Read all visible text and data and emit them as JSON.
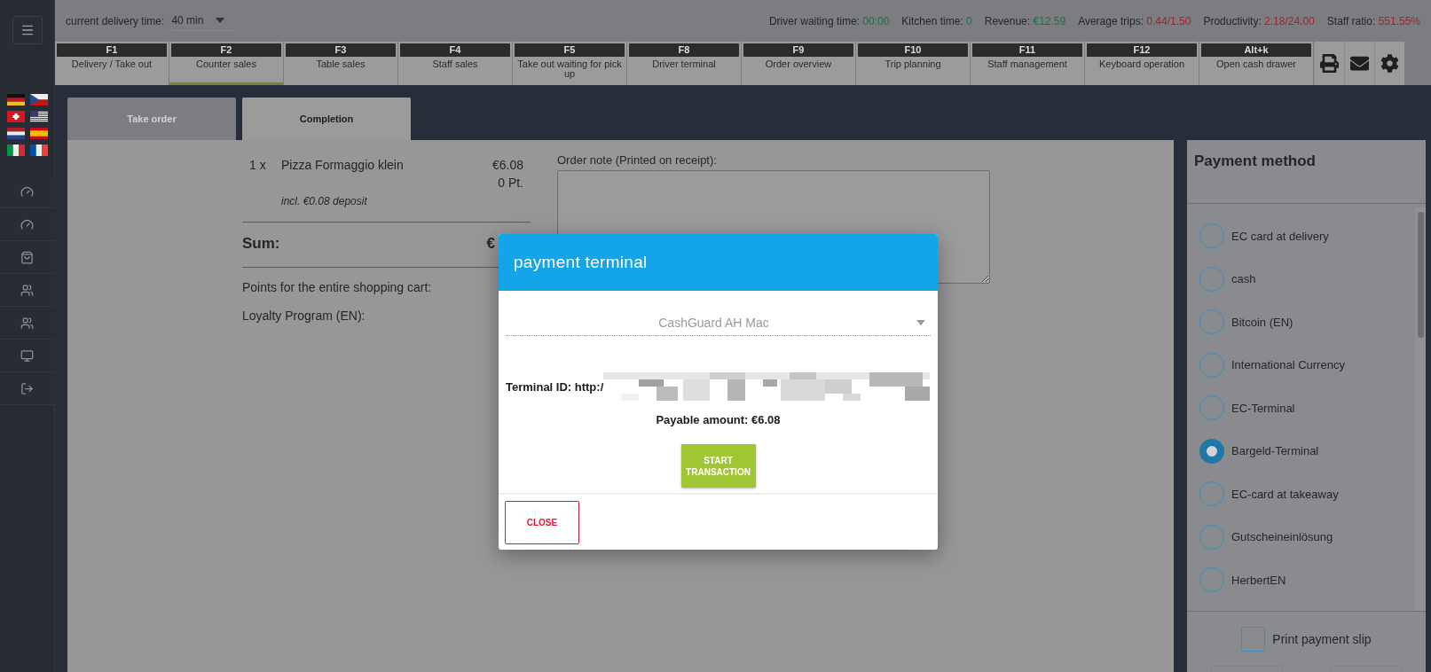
{
  "header": {
    "delivery_time_label": "current delivery time:",
    "delivery_time_value": "40 min",
    "stats": [
      {
        "label": "Driver waiting time:",
        "value": "00:00",
        "color": "#1f6d45"
      },
      {
        "label": "Kitchen time:",
        "value": "0",
        "color": "#1f6d45"
      },
      {
        "label": "Revenue:",
        "value": "€12.59",
        "color": "#1f6d45"
      },
      {
        "label": "Average trips:",
        "value": "0.44/1.50",
        "color": "#a8202f"
      },
      {
        "label": "Productivity:",
        "value": "2.18/24.00",
        "color": "#a8202f"
      },
      {
        "label": "Staff ratio:",
        "value": "551.55%",
        "color": "#a8202f"
      }
    ]
  },
  "function_keys": [
    {
      "key": "F1",
      "label": "Delivery / Take out",
      "selected": false
    },
    {
      "key": "F2",
      "label": "Counter sales",
      "selected": true
    },
    {
      "key": "F3",
      "label": "Table sales",
      "selected": false
    },
    {
      "key": "F4",
      "label": "Staff sales",
      "selected": false
    },
    {
      "key": "F5",
      "label": "Take out waiting for pick up",
      "selected": false
    },
    {
      "key": "F8",
      "label": "Driver terminal",
      "selected": false
    },
    {
      "key": "F9",
      "label": "Order overview",
      "selected": false
    },
    {
      "key": "F10",
      "label": "Trip planning",
      "selected": false
    },
    {
      "key": "F11",
      "label": "Staff management",
      "selected": false
    },
    {
      "key": "F12",
      "label": "Keyboard operation",
      "selected": false
    },
    {
      "key": "Alt+k",
      "label": "Open cash drawer",
      "selected": false
    }
  ],
  "order_tabs": [
    {
      "label": "Take order",
      "selected": false
    },
    {
      "label": "Completion",
      "selected": true
    }
  ],
  "order": {
    "items": [
      {
        "quantity": "1 x",
        "name": "Pizza Formaggio klein",
        "price": "€6.08",
        "points": "0 Pt.",
        "note": "incl. €0.08 deposit"
      }
    ],
    "sum_label": "Sum:",
    "sum_value": "€",
    "points_label": "Points for the entire shopping cart:",
    "loyalty_label": "Loyalty Program (EN):"
  },
  "order_note": {
    "label": "Order note (Printed on receipt):"
  },
  "payment": {
    "title": "Payment method",
    "methods": [
      {
        "label": "EC card at delivery",
        "selected": false
      },
      {
        "label": "cash",
        "selected": false
      },
      {
        "label": "Bitcoin (EN)",
        "selected": false
      },
      {
        "label": "International Currency",
        "selected": false
      },
      {
        "label": "EC-Terminal",
        "selected": false
      },
      {
        "label": "Bargeld-Terminal",
        "selected": true
      },
      {
        "label": "EC-card at takeaway",
        "selected": false
      },
      {
        "label": "Gutscheineinlösung",
        "selected": false
      },
      {
        "label": "HerbertEN",
        "selected": false
      }
    ],
    "print_slip": {
      "label": "Print payment slip",
      "checked": false
    }
  },
  "dialog": {
    "title": "payment terminal",
    "terminal_select": "CashGuard AH Mac",
    "terminal_id": "Terminal ID: http:/",
    "payable": "Payable amount: €6.08",
    "start_button": "START TRANSACTION",
    "close_button": "CLOSE"
  }
}
